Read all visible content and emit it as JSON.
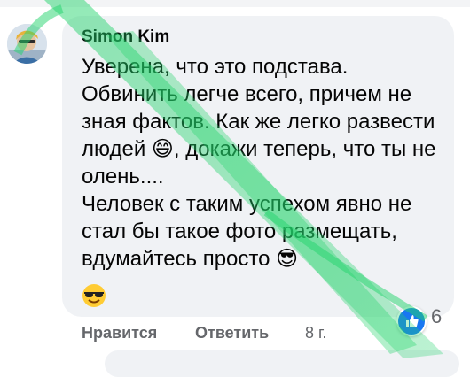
{
  "comment": {
    "author": "Simon Kim",
    "text": "Уверена, что это подстава.\nОбвинить легче всего, причем не зная фактов. Как же легко развести людей 😄, докажи теперь, что ты не олень....\nЧеловек с таким успехом явно не стал бы такое фото размещать, вдумайтесь просто 😎",
    "emoji_1": "😄",
    "emoji_2": "😎",
    "reaction_icon": "like-icon",
    "reaction_count": "6",
    "actions": {
      "like_label": "Нравится",
      "reply_label": "Ответить",
      "time": "8 г."
    }
  },
  "colors": {
    "bubble": "#f0f2f5",
    "text": "#050505",
    "muted": "#65676b",
    "like_blue": "#1877f2",
    "watermark": "#22d36b"
  }
}
